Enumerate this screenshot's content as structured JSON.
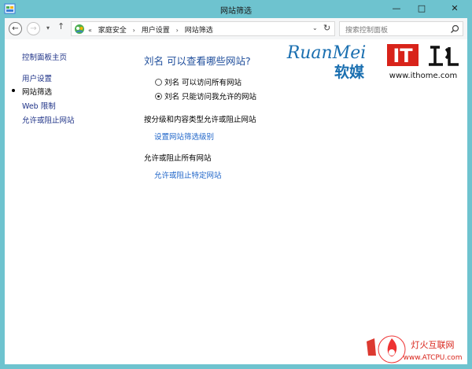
{
  "window": {
    "title": "网站筛选",
    "minimize_glyph": "—",
    "maximize_glyph": "□",
    "close_glyph": "✕"
  },
  "navigation": {
    "back_glyph": "←",
    "forward_glyph": "→",
    "recent_glyph": "▾",
    "up_glyph": "↑"
  },
  "address_bar": {
    "chevron": "«",
    "breadcrumbs": [
      "家庭安全",
      "用户设置",
      "网站筛选"
    ],
    "separator": "›",
    "dropdown_glyph": "⌄",
    "refresh_glyph": "↻"
  },
  "search": {
    "placeholder": "搜索控制面板",
    "icon": "search-icon"
  },
  "sidebar": {
    "home_link": "控制面板主页",
    "items": [
      {
        "label": "用户设置",
        "current": false
      },
      {
        "label": "网站筛选",
        "current": true
      },
      {
        "label": "Web 限制",
        "current": false
      },
      {
        "label": "允许或阻止网站",
        "current": false
      }
    ]
  },
  "main": {
    "title": "刘名 可以查看哪些网站?",
    "options": [
      {
        "label": "刘名 可以访问所有网站",
        "selected": false
      },
      {
        "label": "刘名 只能访问我允许的网站",
        "selected": true
      }
    ],
    "section1_heading": "按分级和内容类型允许或阻止网站",
    "section1_link": "设置网站筛选级别",
    "section2_heading": "允许或阻止所有网站",
    "section2_link": "允许或阻止特定网站"
  },
  "watermarks": {
    "ruanmei_latin": "RuanMei",
    "ruanmei_cn": "软媒",
    "ithome_logo": "IT之家",
    "ithome_url": "www.ithome.com",
    "corner_cn": "灯火互联网",
    "corner_url": "www.ATCPU.com"
  },
  "colors": {
    "titlebar": "#6ec3cf",
    "link": "#1e3287",
    "accent_link": "#1e64c8",
    "ithome_red": "#d8231a",
    "ruanmei_blue": "#1a6fb0"
  }
}
